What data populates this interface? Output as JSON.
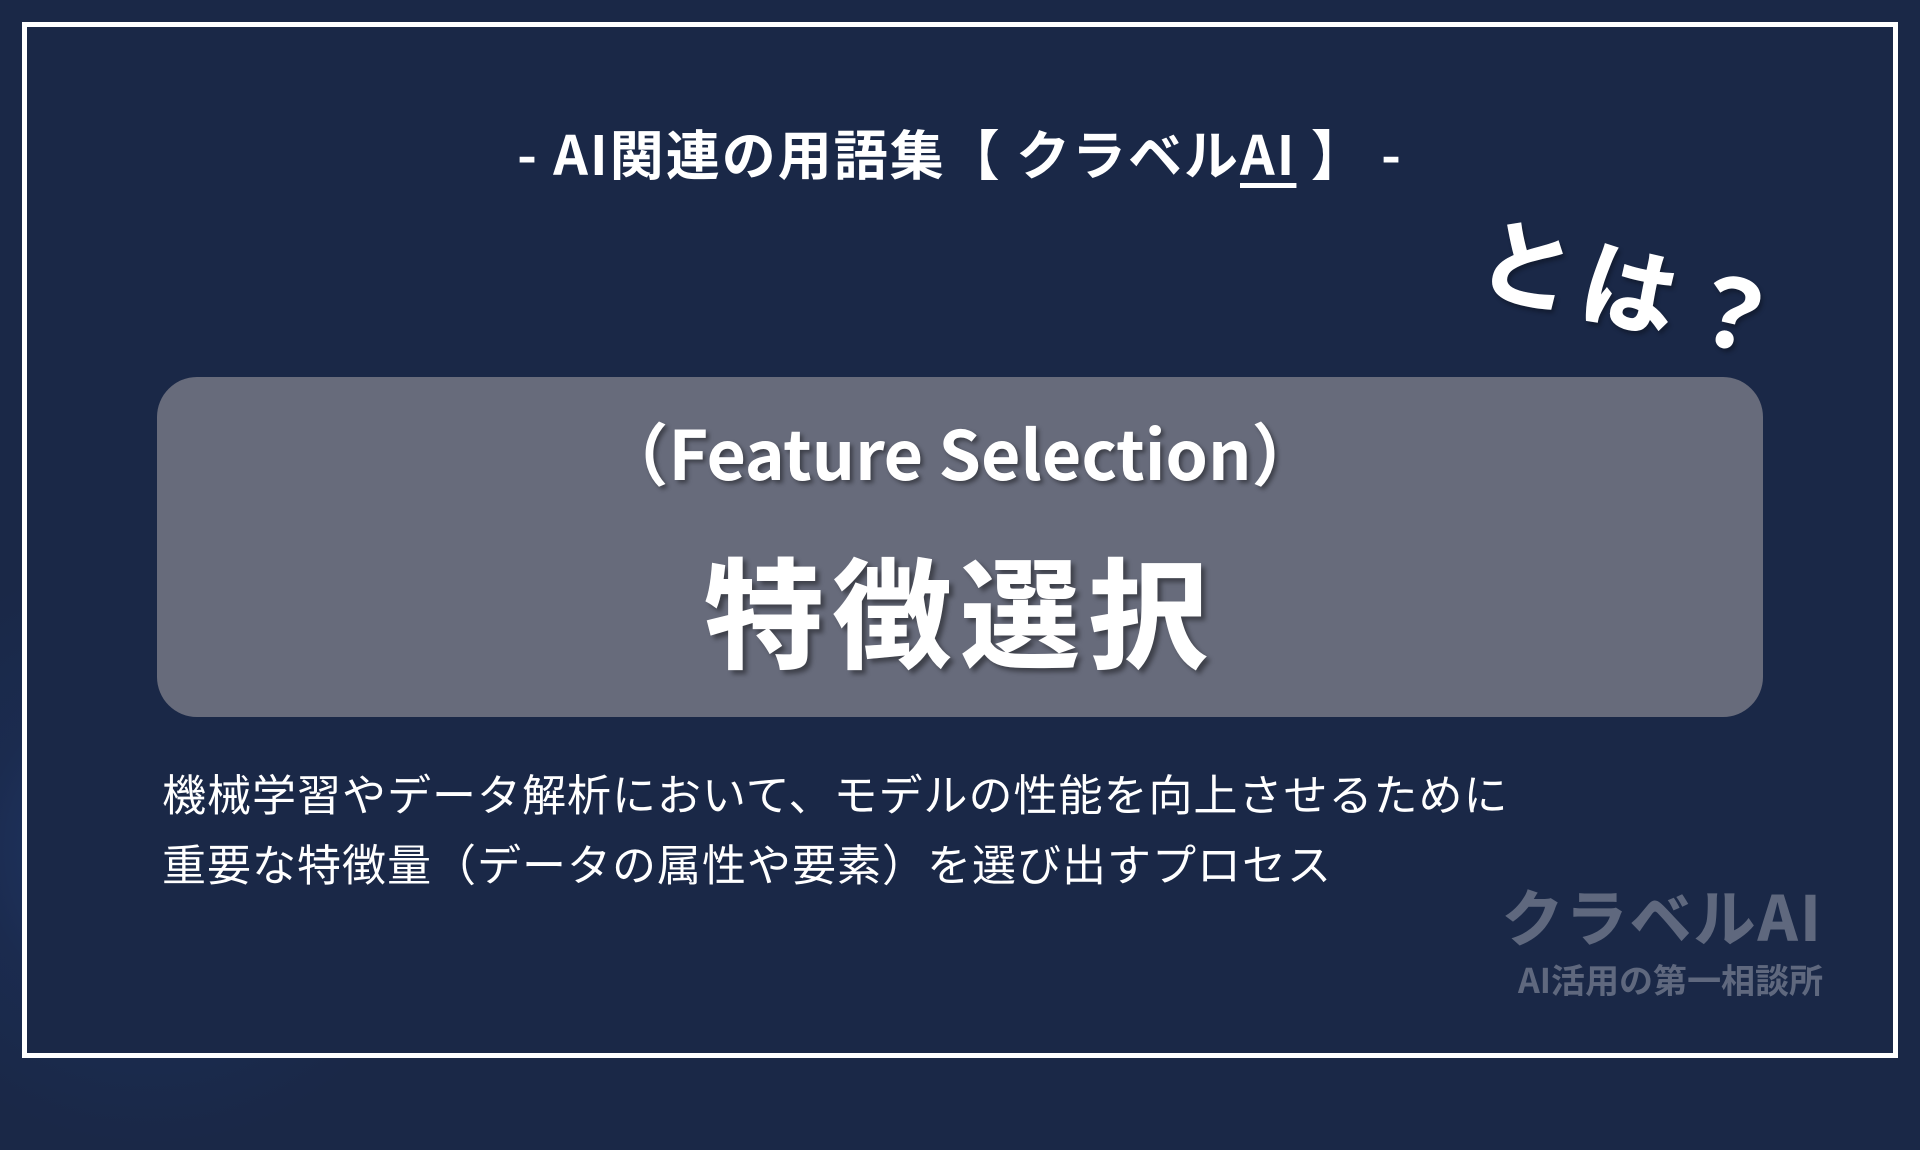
{
  "header": {
    "prefix": "- ",
    "text_part1": "AI関連の用語集【 クラベル",
    "text_ai": "AI",
    "text_part2": " 】",
    "suffix": " -"
  },
  "towa_badge": "とは？",
  "content": {
    "subtitle": "（Feature Selection）",
    "main_title": "特徴選択"
  },
  "description": {
    "line1": "機械学習やデータ解析において、モデルの性能を向上させるために",
    "line2": "重要な特徴量（データの属性や要素）を選び出すプロセス"
  },
  "brand": {
    "name": "クラベルAI",
    "tagline": "AI活用の第一相談所"
  }
}
